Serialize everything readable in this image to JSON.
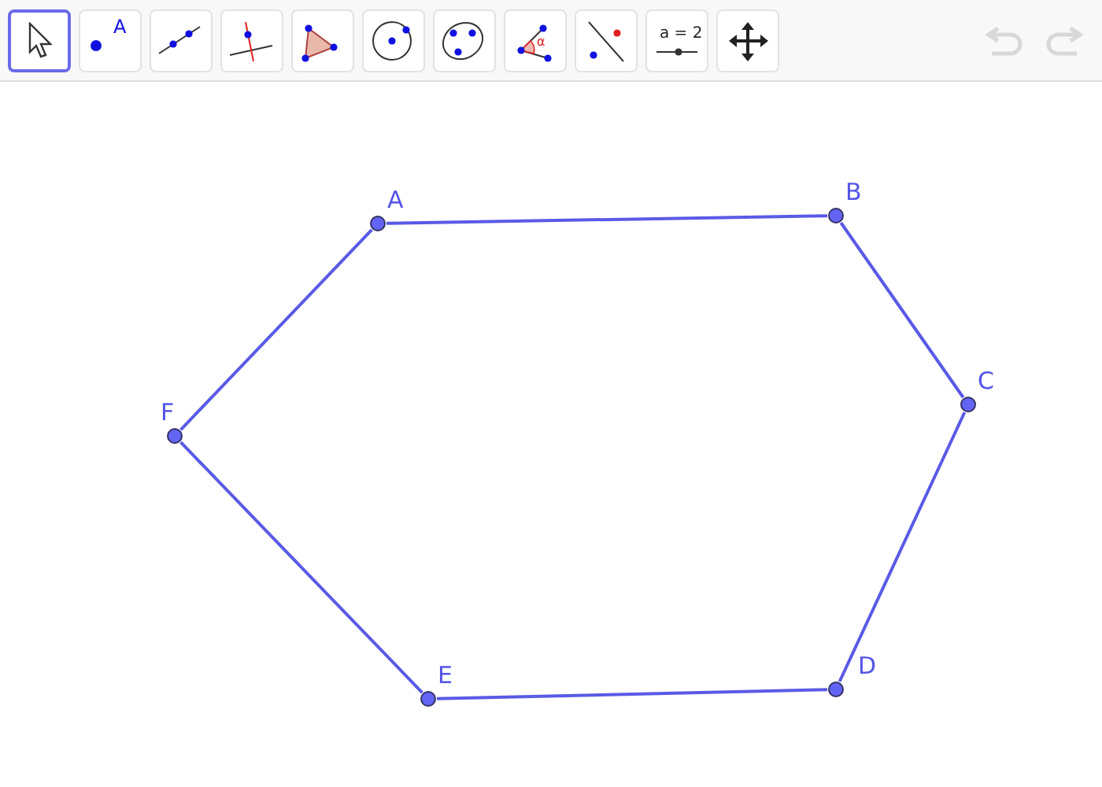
{
  "toolbar": {
    "tools": [
      {
        "kind": "move",
        "selected": true
      },
      {
        "kind": "point",
        "selected": false,
        "text": "A"
      },
      {
        "kind": "line",
        "selected": false
      },
      {
        "kind": "perpendicular",
        "selected": false
      },
      {
        "kind": "polygon",
        "selected": false
      },
      {
        "kind": "circle",
        "selected": false
      },
      {
        "kind": "conic",
        "selected": false
      },
      {
        "kind": "angle",
        "selected": false,
        "text": "α"
      },
      {
        "kind": "reflect",
        "selected": false
      },
      {
        "kind": "slider",
        "selected": false,
        "text": "a = 2"
      },
      {
        "kind": "pan",
        "selected": false
      }
    ],
    "undo": {
      "disabled": true
    },
    "redo": {
      "disabled": true
    }
  },
  "canvas": {
    "polygon": {
      "vertices": [
        {
          "label": "A"
        },
        {
          "label": "B"
        },
        {
          "label": "C"
        },
        {
          "label": "D"
        },
        {
          "label": "E"
        },
        {
          "label": "F"
        }
      ]
    }
  }
}
